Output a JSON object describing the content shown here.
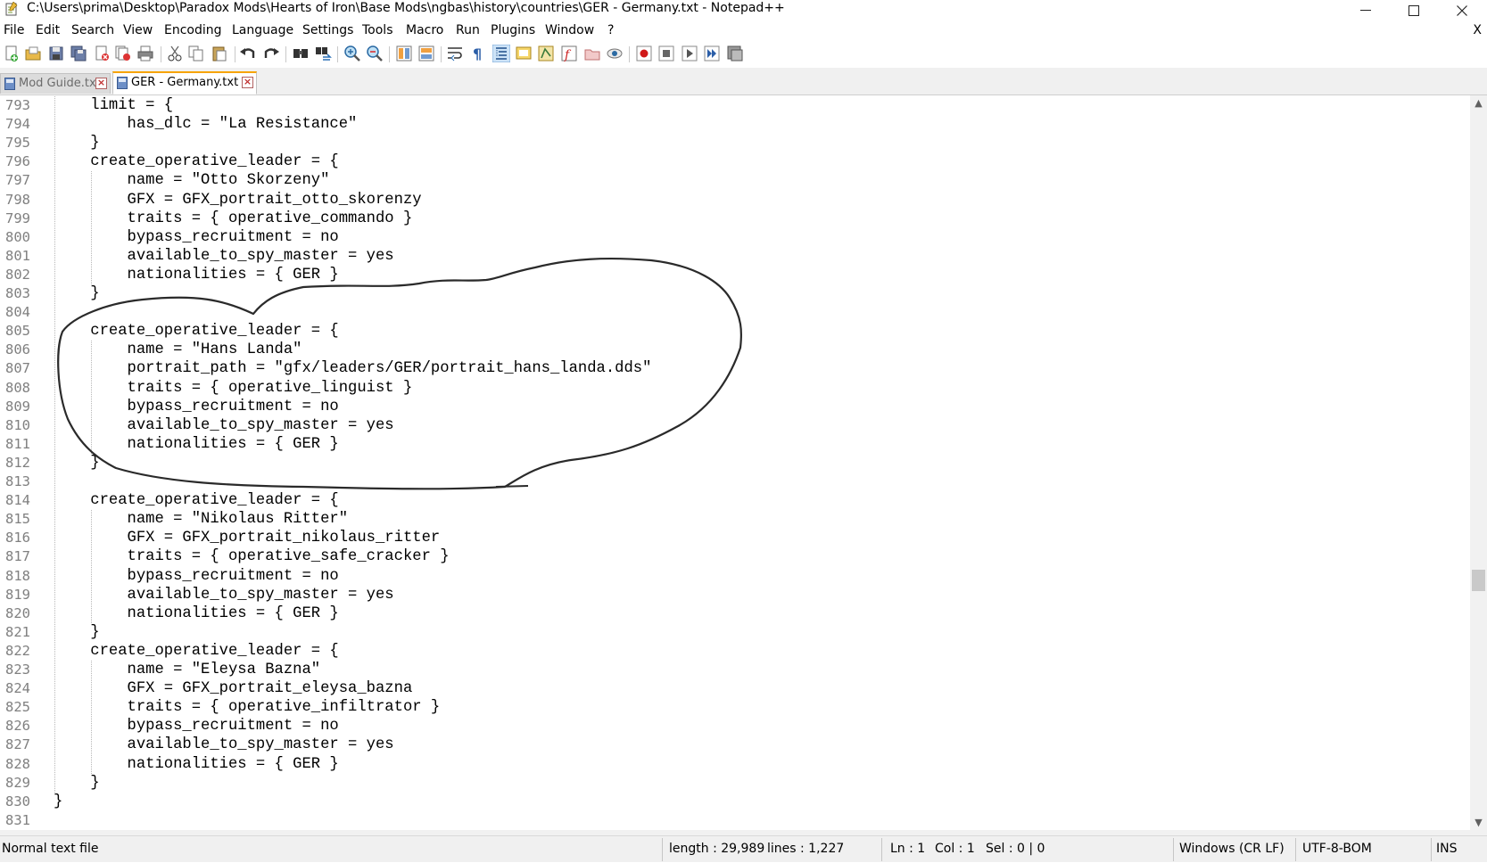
{
  "window": {
    "title": "C:\\Users\\prima\\Desktop\\Paradox Mods\\Hearts of Iron\\Base Mods\\ngbas\\history\\countries\\GER - Germany.txt - Notepad++",
    "minimize": "—",
    "maximize": "☐",
    "close": "✕"
  },
  "menu": {
    "items": [
      "File",
      "Edit",
      "Search",
      "View",
      "Encoding",
      "Language",
      "Settings",
      "Tools",
      "Macro",
      "Run",
      "Plugins",
      "Window",
      "?"
    ],
    "close_doc": "X"
  },
  "toolbar": {
    "icons": [
      "new-file-icon",
      "open-file-icon",
      "save-icon",
      "save-all-icon",
      "close-icon",
      "close-all-icon",
      "print-icon",
      "cut-icon",
      "copy-icon",
      "paste-icon",
      "undo-icon",
      "redo-icon",
      "find-icon",
      "replace-icon",
      "zoom-in-icon",
      "zoom-out-icon",
      "sync-vertical-icon",
      "sync-horizontal-icon",
      "word-wrap-icon",
      "show-all-chars-icon",
      "indent-guide-icon",
      "user-language-icon",
      "doc-map-icon",
      "function-list-icon",
      "folder-workspace-icon",
      "monitoring-icon",
      "record-macro-icon",
      "stop-macro-icon",
      "play-macro-icon",
      "run-macro-multiple-icon",
      "save-macro-icon"
    ]
  },
  "tabs": [
    {
      "label": "Mod Guide.txt",
      "active": false
    },
    {
      "label": "GER - Germany.txt",
      "active": true
    }
  ],
  "editor": {
    "lines": [
      {
        "n": "793",
        "text": "    limit = {"
      },
      {
        "n": "794",
        "text": "        has_dlc = \"La Resistance\""
      },
      {
        "n": "795",
        "text": "    }"
      },
      {
        "n": "796",
        "text": "    create_operative_leader = {"
      },
      {
        "n": "797",
        "text": "        name = \"Otto Skorzeny\""
      },
      {
        "n": "798",
        "text": "        GFX = GFX_portrait_otto_skorenzy"
      },
      {
        "n": "799",
        "text": "        traits = { operative_commando }"
      },
      {
        "n": "800",
        "text": "        bypass_recruitment = no"
      },
      {
        "n": "801",
        "text": "        available_to_spy_master = yes"
      },
      {
        "n": "802",
        "text": "        nationalities = { GER }"
      },
      {
        "n": "803",
        "text": "    }"
      },
      {
        "n": "804",
        "text": ""
      },
      {
        "n": "805",
        "text": "    create_operative_leader = {"
      },
      {
        "n": "806",
        "text": "        name = \"Hans Landa\""
      },
      {
        "n": "807",
        "text": "        portrait_path = \"gfx/leaders/GER/portrait_hans_landa.dds\""
      },
      {
        "n": "808",
        "text": "        traits = { operative_linguist }"
      },
      {
        "n": "809",
        "text": "        bypass_recruitment = no"
      },
      {
        "n": "810",
        "text": "        available_to_spy_master = yes"
      },
      {
        "n": "811",
        "text": "        nationalities = { GER }"
      },
      {
        "n": "812",
        "text": "    }"
      },
      {
        "n": "813",
        "text": ""
      },
      {
        "n": "814",
        "text": "    create_operative_leader = {"
      },
      {
        "n": "815",
        "text": "        name = \"Nikolaus Ritter\""
      },
      {
        "n": "816",
        "text": "        GFX = GFX_portrait_nikolaus_ritter"
      },
      {
        "n": "817",
        "text": "        traits = { operative_safe_cracker }"
      },
      {
        "n": "818",
        "text": "        bypass_recruitment = no"
      },
      {
        "n": "819",
        "text": "        available_to_spy_master = yes"
      },
      {
        "n": "820",
        "text": "        nationalities = { GER }"
      },
      {
        "n": "821",
        "text": "    }"
      },
      {
        "n": "822",
        "text": "    create_operative_leader = {"
      },
      {
        "n": "823",
        "text": "        name = \"Eleysa Bazna\""
      },
      {
        "n": "824",
        "text": "        GFX = GFX_portrait_eleysa_bazna"
      },
      {
        "n": "825",
        "text": "        traits = { operative_infiltrator }"
      },
      {
        "n": "826",
        "text": "        bypass_recruitment = no"
      },
      {
        "n": "827",
        "text": "        available_to_spy_master = yes"
      },
      {
        "n": "828",
        "text": "        nationalities = { GER }"
      },
      {
        "n": "829",
        "text": "    }"
      },
      {
        "n": "830",
        "text": "}"
      },
      {
        "n": "831",
        "text": ""
      }
    ]
  },
  "status": {
    "file_type": "Normal text file",
    "length": "length : 29,989",
    "lines": "lines : 1,227",
    "ln": "Ln : 1",
    "col": "Col : 1",
    "sel": "Sel : 0 | 0",
    "eol": "Windows (CR LF)",
    "encoding": "UTF-8-BOM",
    "mode": "INS"
  },
  "colors": {
    "active_tab_accent": "#f7a400",
    "line_number": "#808080",
    "annotation_stroke": "#2a2a2a"
  }
}
